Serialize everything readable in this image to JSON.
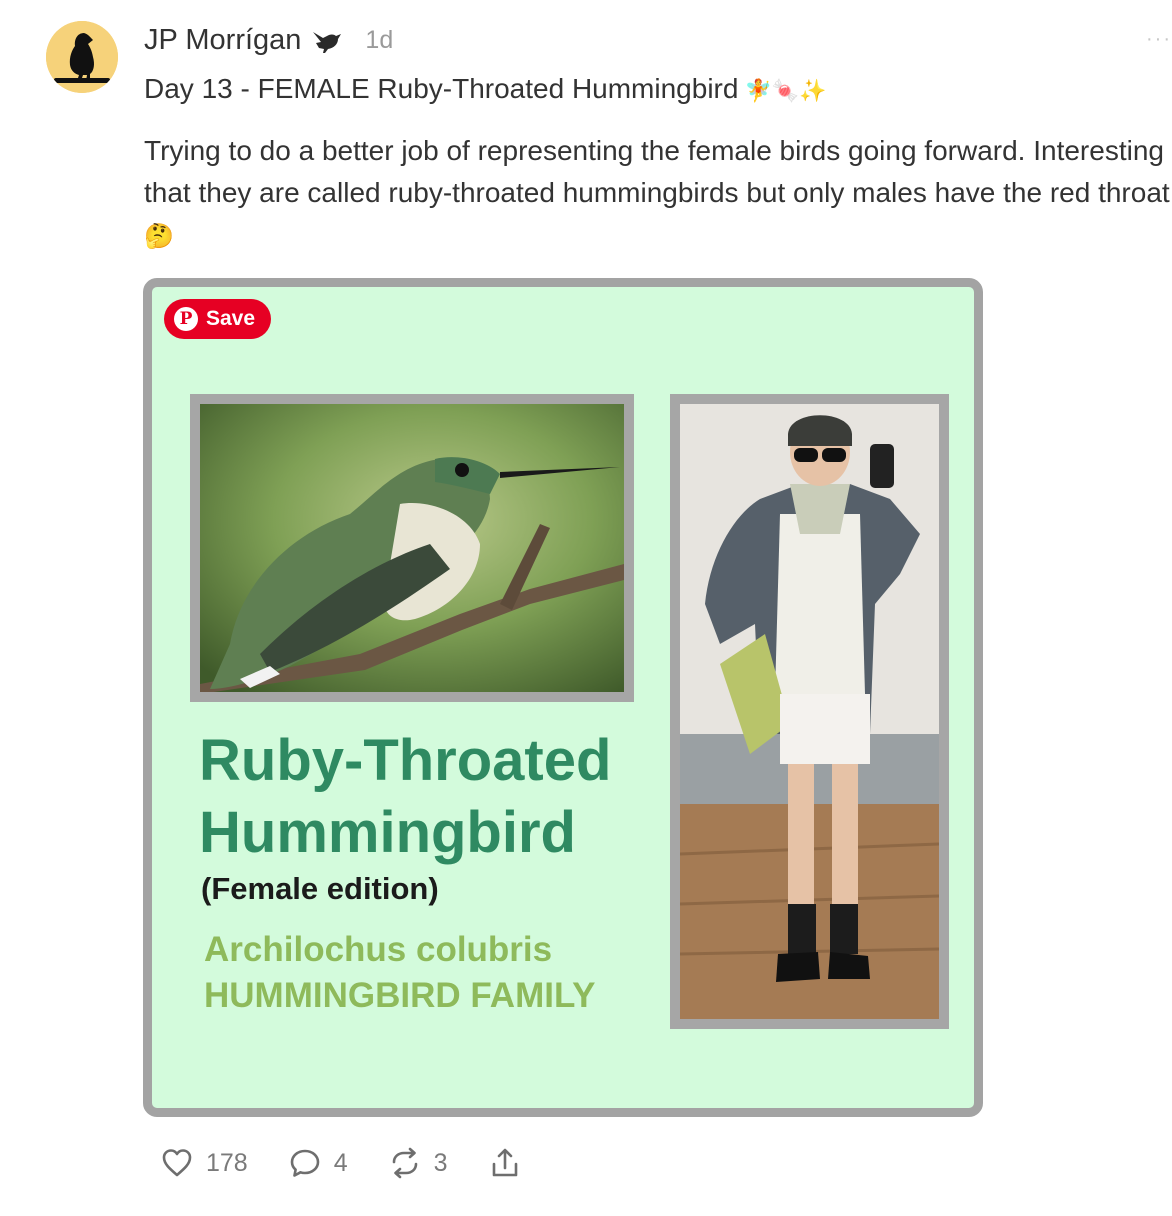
{
  "post": {
    "author": "JP Morrígan",
    "time": "1d",
    "title": "Day 13 - FEMALE Ruby-Throated Hummingbird",
    "title_emoji": "🧚🍬✨",
    "body_text": "Trying to do a better job of representing the female birds going forward. Interesting that they are called ruby-throated hummingbirds but only males have the red throat",
    "body_emoji": "🤔",
    "more_label": "···"
  },
  "card": {
    "save_label": "Save",
    "save_icon": "pinterest-icon",
    "title_line1": "Ruby-Throated",
    "title_line2": "Hummingbird",
    "subtitle": "(Female edition)",
    "scientific_name": "Archilochus colubris",
    "family": "HUMMINGBIRD FAMILY",
    "colors": {
      "background": "#d3fbdc",
      "title": "#2f8a62",
      "scientific": "#8eba5b",
      "frame": "#a6a6a6"
    }
  },
  "actions": {
    "likes": "178",
    "comments": "4",
    "restacks": "3",
    "icons": [
      "heart-icon",
      "comment-icon",
      "restack-icon",
      "share-icon"
    ]
  }
}
